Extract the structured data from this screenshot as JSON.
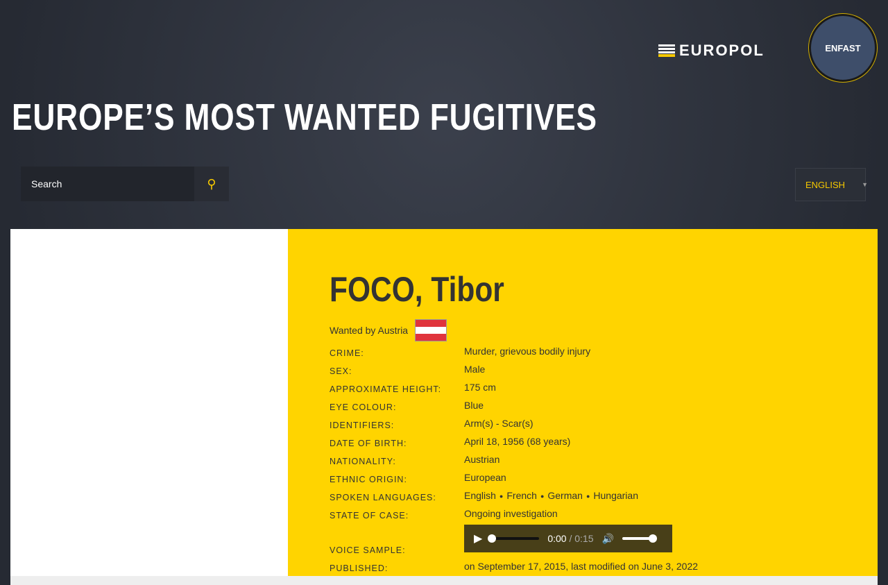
{
  "header": {
    "europol_logo": "EUROPOL",
    "enfast_logo": "ENFAST",
    "title": "EUROPE’S MOST WANTED FUGITIVES"
  },
  "search": {
    "placeholder": "Search"
  },
  "language": {
    "selected": "ENGLISH"
  },
  "fugitive": {
    "name": "FOCO, Tibor",
    "wanted_by": "Wanted by Austria",
    "fields": [
      {
        "label": "CRIME:",
        "value": "Murder, grievous bodily injury"
      },
      {
        "label": "SEX:",
        "value": "Male"
      },
      {
        "label": "APPROXIMATE HEIGHT:",
        "value": "175 cm"
      },
      {
        "label": "EYE COLOUR:",
        "value": "Blue"
      },
      {
        "label": "IDENTIFIERS:",
        "value": "Arm(s) - Scar(s)"
      },
      {
        "label": "DATE OF BIRTH:",
        "value": "April 18, 1956 (68 years)"
      },
      {
        "label": "NATIONALITY:",
        "value": "Austrian"
      },
      {
        "label": "ETHNIC ORIGIN:",
        "value": "European"
      }
    ],
    "languages_label": "SPOKEN LANGUAGES:",
    "languages": [
      "English",
      "French",
      "German",
      "Hungarian"
    ],
    "state_label": "STATE OF CASE:",
    "state": "Ongoing investigation",
    "voice_label": "VOICE SAMPLE:",
    "audio": {
      "current": "0:00",
      "duration": "/ 0:15",
      "progress": 0,
      "volume": 1
    },
    "published_label": "PUBLISHED:",
    "published": "on September 17, 2015, last modified on June 3, 2022"
  }
}
